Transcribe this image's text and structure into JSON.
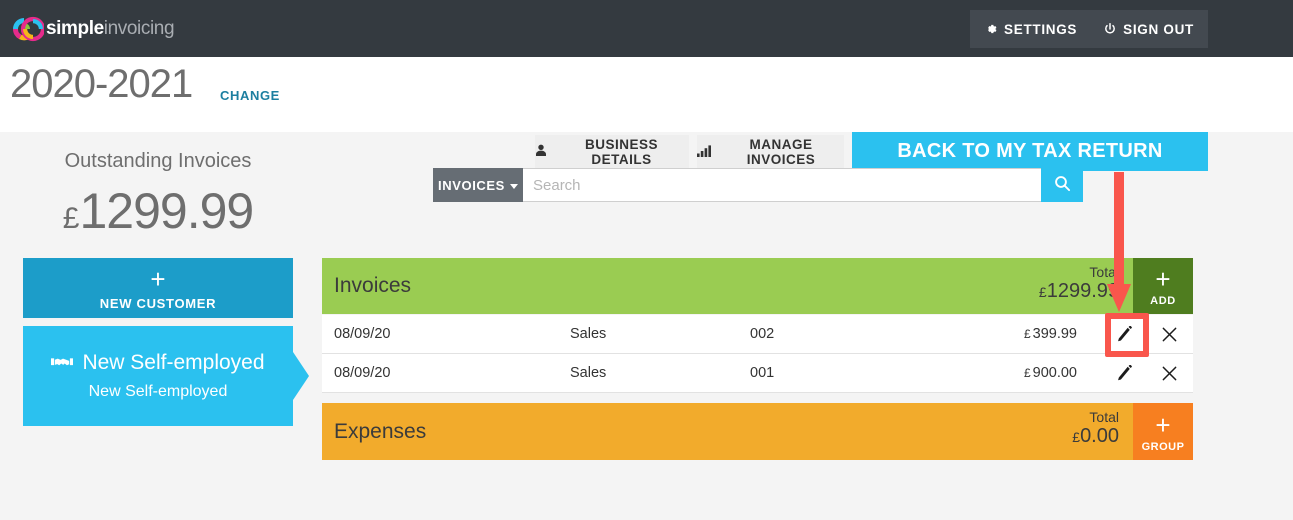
{
  "topbar": {
    "logo": {
      "bold": "simple",
      "light": "invoicing",
      "icon": "go-logo-icon"
    },
    "settings_label": "SETTINGS",
    "signout_label": "SIGN OUT"
  },
  "subheader": {
    "year": "2020-2021",
    "change_label": "CHANGE",
    "business_details_label": "BUSINESS DETAILS",
    "manage_invoices_label": "MANAGE INVOICES",
    "back_label": "BACK TO MY TAX RETURN"
  },
  "sidebar": {
    "outstanding_label": "Outstanding Invoices",
    "outstanding_currency": "£",
    "outstanding_amount": "1299.99",
    "new_customer_label": "NEW CUSTOMER",
    "self_employed_title": "New Self-employed",
    "self_employed_subtitle": "New Self-employed"
  },
  "search": {
    "filter_label": "INVOICES",
    "placeholder": "Search",
    "value": ""
  },
  "invoices": {
    "title": "Invoices",
    "total_label": "Total",
    "total_currency": "£",
    "total_amount": "1299.99",
    "add_label": "ADD",
    "rows": [
      {
        "date": "08/09/20",
        "type": "Sales",
        "number": "002",
        "currency": "£",
        "amount": "399.99"
      },
      {
        "date": "08/09/20",
        "type": "Sales",
        "number": "001",
        "currency": "£",
        "amount": "900.00"
      }
    ]
  },
  "expenses": {
    "title": "Expenses",
    "total_label": "Total",
    "total_currency": "£",
    "total_amount": "0.00",
    "group_label": "GROUP"
  },
  "colors": {
    "topbar": "#343a40",
    "cyan": "#2bc1ef",
    "blue": "#1c9dc9",
    "green": "#9acc52",
    "dark_green": "#4f7d1f",
    "amber": "#f2ab2c",
    "orange": "#f77f20",
    "annotation_red": "#f9564c",
    "link_blue": "#1d7fa0"
  }
}
